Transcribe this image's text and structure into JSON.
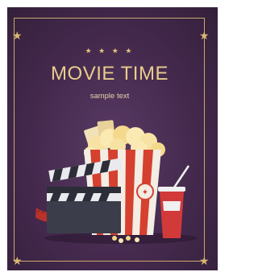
{
  "poster": {
    "stars": "★ ★ ★ ★",
    "title": "MOVIE TIME",
    "subtitle": "sample text",
    "corner_star": "★"
  },
  "colors": {
    "background": "#44294d",
    "frame_gold": "#c9a96a",
    "title_gold": "#e8cd8c",
    "popcorn_red": "#d5402f",
    "cup_red": "#d23a3a"
  }
}
